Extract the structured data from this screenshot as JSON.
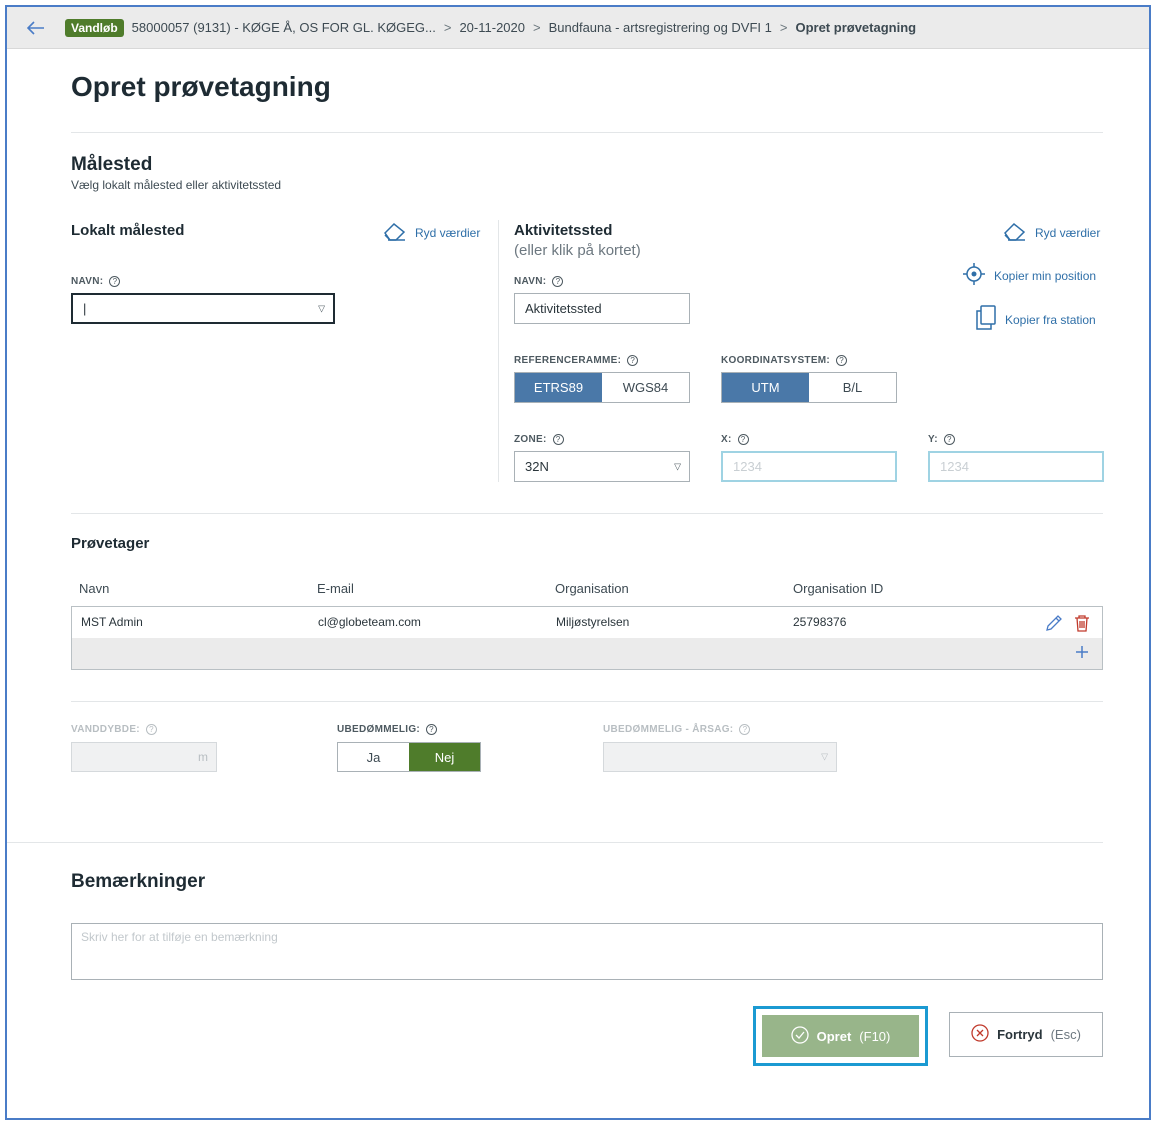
{
  "breadcrumb": {
    "badge": "Vandløb",
    "item1": "58000057 (9131) - KØGE Å, OS FOR GL. KØGEG...",
    "item2": "20-11-2020",
    "item3": "Bundfauna - artsregistrering og DVFI 1",
    "current": "Opret prøvetagning",
    "sep": ">"
  },
  "page_title": "Opret prøvetagning",
  "malested": {
    "title": "Målested",
    "subtitle": "Vælg lokalt målested eller aktivitetssted"
  },
  "lokalt": {
    "title": "Lokalt målested",
    "clear_label": "Ryd værdier",
    "navn_label": "NAVN:",
    "navn_value": "|"
  },
  "aktivitet": {
    "title": "Aktivitetssted",
    "subtitle": "(eller klik på kortet)",
    "clear_label": "Ryd værdier",
    "copy_position_label": "Kopier min position",
    "copy_station_label": "Kopier fra station",
    "navn_label": "NAVN:",
    "navn_value": "Aktivitetssted",
    "ref_label": "REFERENCERAMME:",
    "ref_options": [
      "ETRS89",
      "WGS84"
    ],
    "ref_selected": "ETRS89",
    "koord_label": "KOORDINATSYSTEM:",
    "koord_options": [
      "UTM",
      "B/L"
    ],
    "koord_selected": "UTM",
    "zone_label": "ZONE:",
    "zone_value": "32N",
    "x_label": "X:",
    "x_placeholder": "1234",
    "y_label": "Y:",
    "y_placeholder": "1234"
  },
  "provetager": {
    "title": "Prøvetager",
    "columns": [
      "Navn",
      "E-mail",
      "Organisation",
      "Organisation ID"
    ],
    "rows": [
      {
        "navn": "MST Admin",
        "email": "cl@globeteam.com",
        "organisation": "Miljøstyrelsen",
        "org_id": "25798376"
      }
    ]
  },
  "extra": {
    "vanddybde_label": "VANDDYBDE:",
    "vanddybde_unit": "m",
    "ubedommelig_label": "UBEDØMMELIG:",
    "ubedommelig_options": [
      "Ja",
      "Nej"
    ],
    "ubedommelig_selected": "Nej",
    "arsag_label": "UBEDØMMELIG - ÅRSAG:"
  },
  "bemaerkninger": {
    "title": "Bemærkninger",
    "placeholder": "Skriv her for at tilføje en bemærkning"
  },
  "actions": {
    "create_label": "Opret",
    "create_shortcut": "(F10)",
    "cancel_label": "Fortryd",
    "cancel_shortcut": "(Esc)"
  },
  "colors": {
    "accent_blue": "#4a78a8",
    "badge_green": "#4f7c2b",
    "create_button": "#98b58a",
    "highlight": "#1b9ad2",
    "delete_red": "#c0392b"
  },
  "icons": [
    "back-arrow-icon",
    "eraser-icon",
    "crosshair-icon",
    "copy-icon",
    "help-icon",
    "pencil-icon",
    "trash-icon",
    "plus-icon",
    "check-circle-icon",
    "x-circle-icon",
    "dropdown-caret-icon"
  ]
}
